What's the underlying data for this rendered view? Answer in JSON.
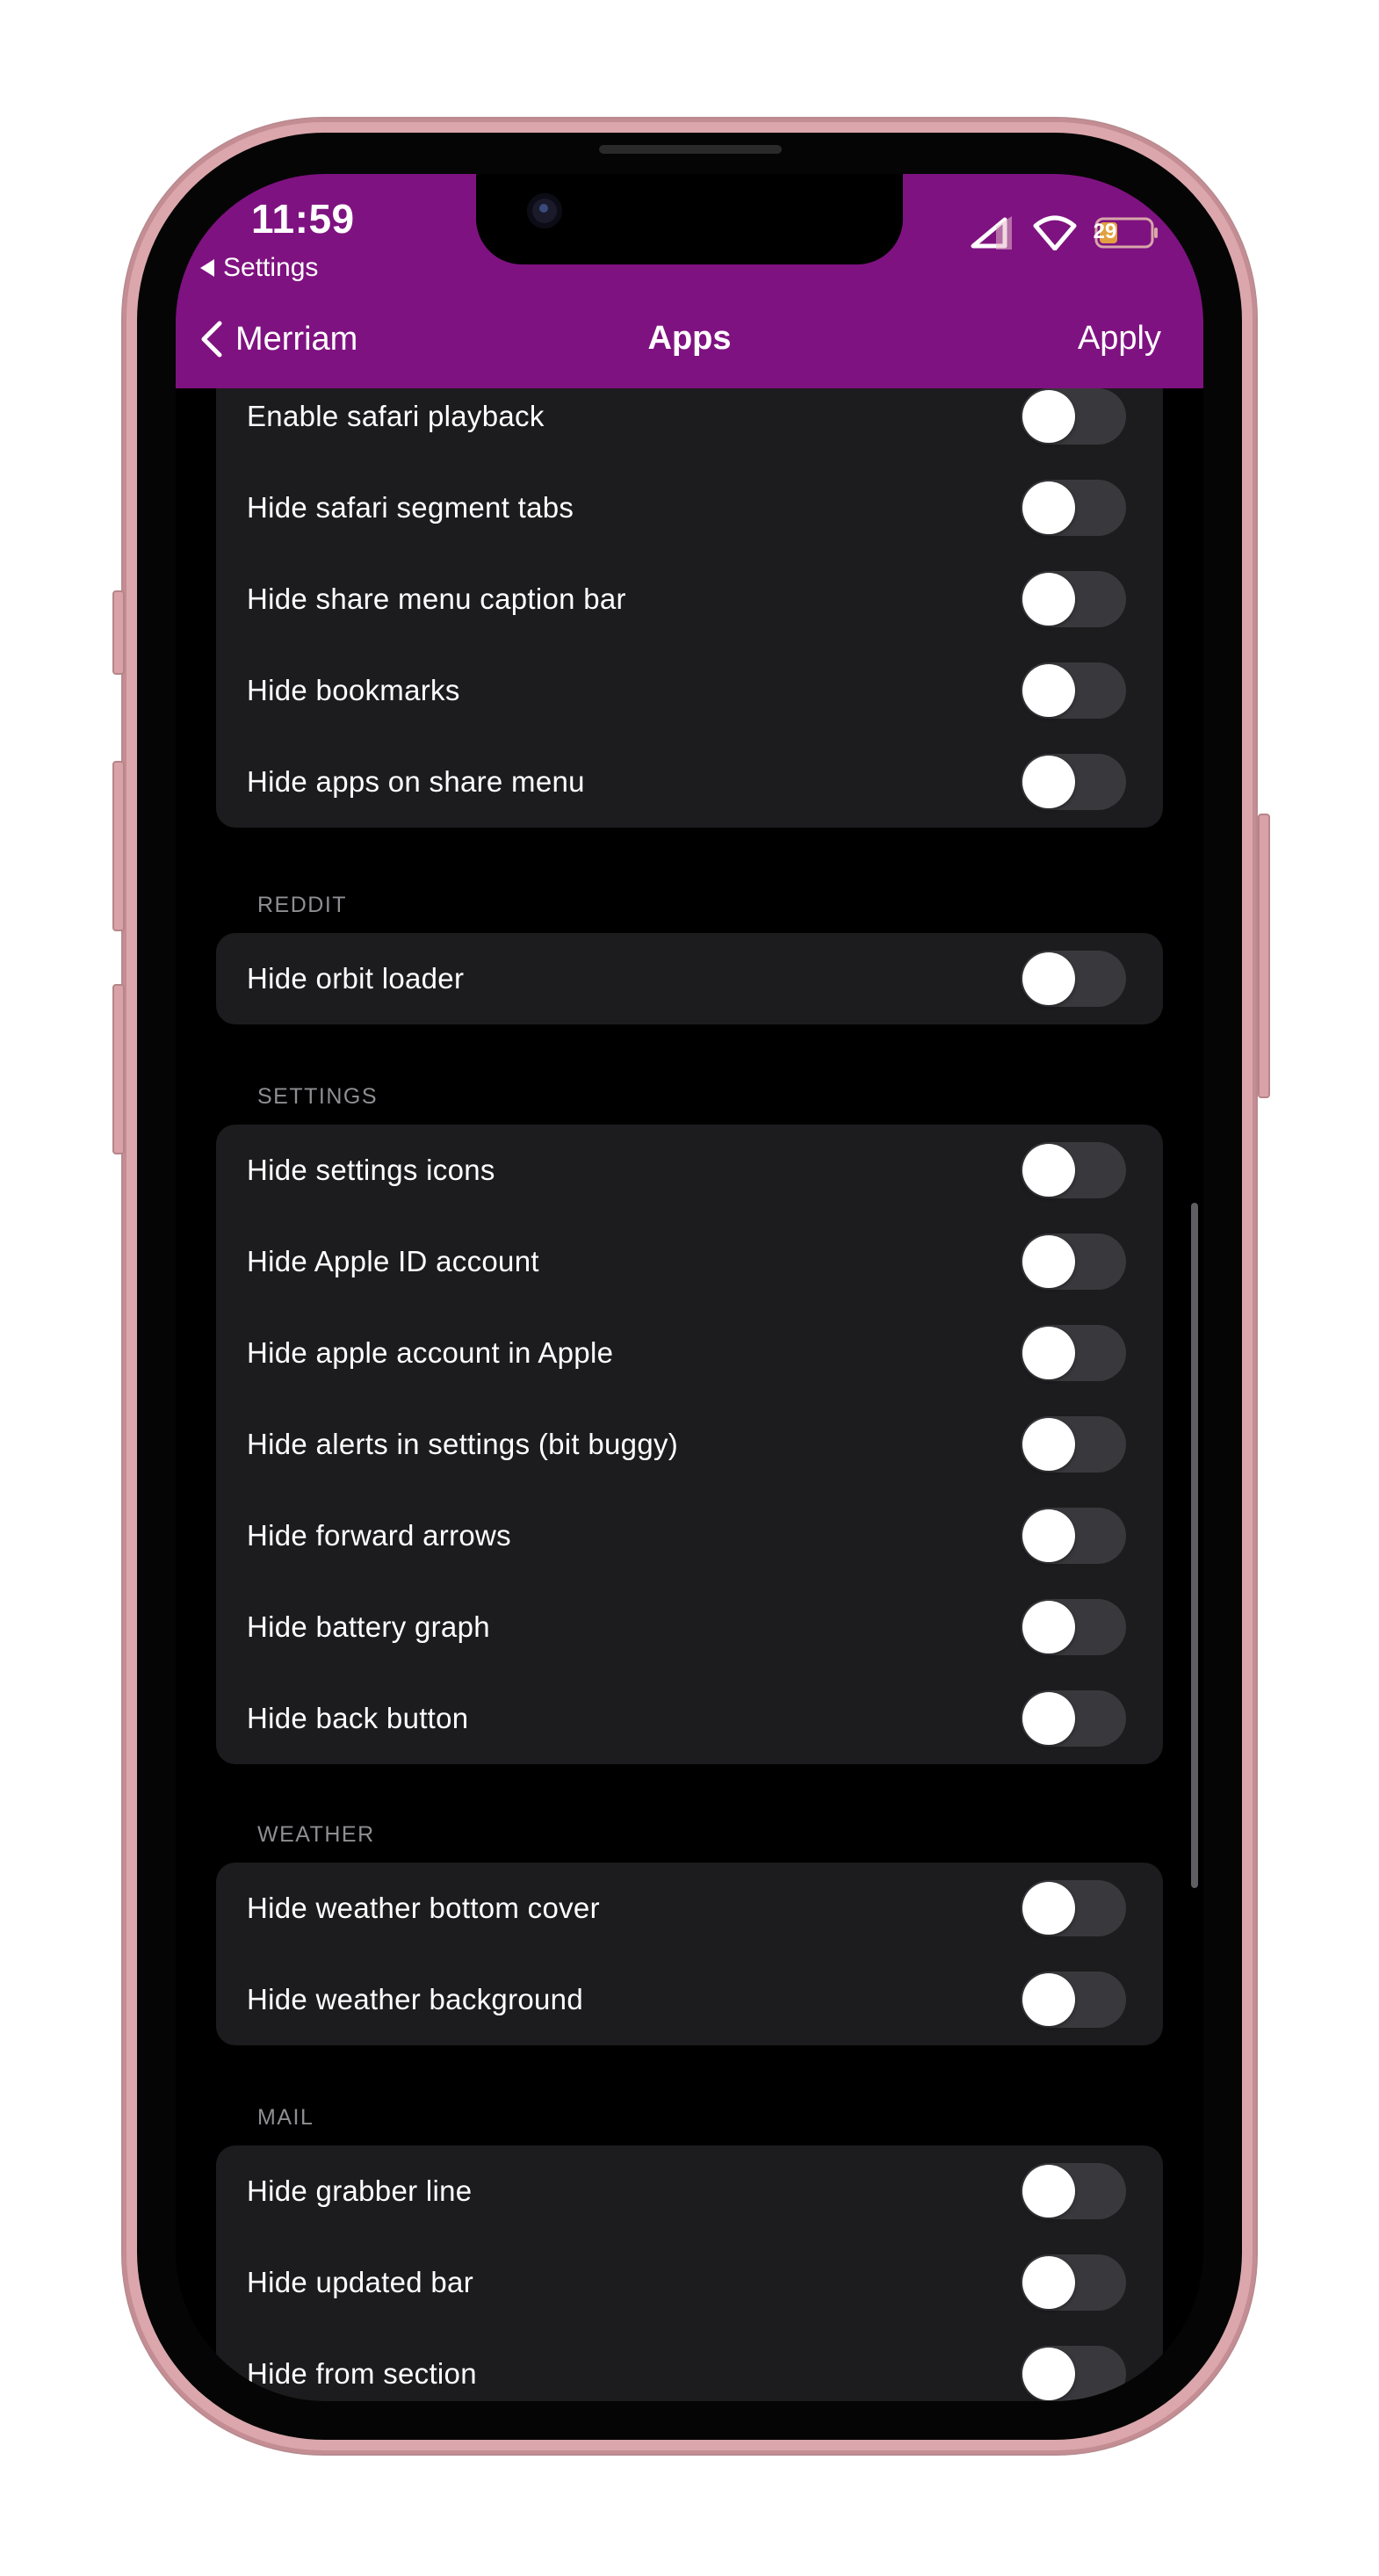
{
  "status_bar": {
    "time": "11:59",
    "back_app": "Settings",
    "battery": "29",
    "signal_icon": "cellular-signal-icon",
    "wifi_icon": "wifi-icon",
    "battery_icon": "battery-icon"
  },
  "nav": {
    "back_label": "Merriam",
    "title": "Apps",
    "apply_label": "Apply"
  },
  "colors": {
    "header": "#7f1281",
    "background": "#000000",
    "group": "#1c1c1e",
    "toggle_off": "#39393d",
    "section_text": "#8e8e93"
  },
  "safari": {
    "rows": [
      {
        "label": "Enable safari playback",
        "on": false
      },
      {
        "label": "Hide safari segment tabs",
        "on": false
      },
      {
        "label": "Hide share menu caption bar",
        "on": false
      },
      {
        "label": "Hide bookmarks",
        "on": false
      },
      {
        "label": "Hide apps on share menu",
        "on": false
      }
    ]
  },
  "reddit": {
    "header": "REDDIT",
    "rows": [
      {
        "label": "Hide orbit loader",
        "on": false
      }
    ]
  },
  "settings": {
    "header": "SETTINGS",
    "rows": [
      {
        "label": "Hide settings icons",
        "on": false
      },
      {
        "label": "Hide Apple ID account",
        "on": false
      },
      {
        "label": "Hide apple account in Apple",
        "on": false
      },
      {
        "label": "Hide alerts in settings (bit buggy)",
        "on": false
      },
      {
        "label": "Hide forward arrows",
        "on": false
      },
      {
        "label": "Hide battery graph",
        "on": false
      },
      {
        "label": "Hide back button",
        "on": false
      }
    ]
  },
  "weather": {
    "header": "WEATHER",
    "rows": [
      {
        "label": "Hide weather bottom cover",
        "on": false
      },
      {
        "label": "Hide weather background",
        "on": false
      }
    ]
  },
  "mail": {
    "header": "MAIL",
    "rows": [
      {
        "label": "Hide grabber line",
        "on": false
      },
      {
        "label": "Hide updated bar",
        "on": false
      },
      {
        "label": "Hide from section",
        "on": false
      }
    ]
  }
}
